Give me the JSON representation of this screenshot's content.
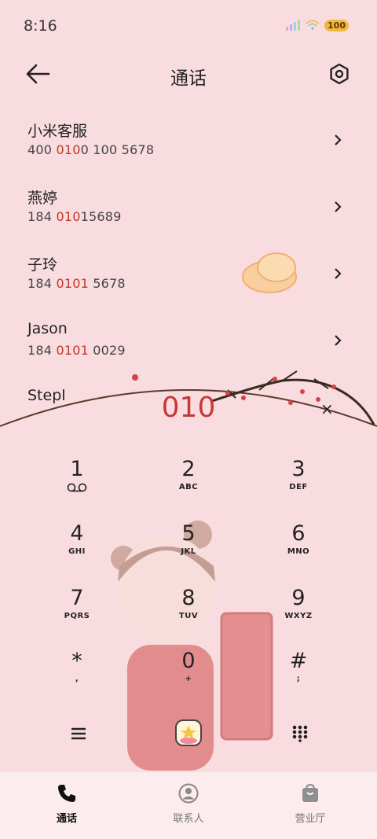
{
  "status": {
    "time": "8:16",
    "battery": "100"
  },
  "header": {
    "title": "通话"
  },
  "contacts": [
    {
      "name": "小米客服",
      "number_pre": "400 ",
      "number_hl": "010",
      "number_mid": "0 ",
      "number_hl2": "",
      "number_post": "100 5678"
    },
    {
      "name": "燕婷",
      "number_pre": "184 ",
      "number_hl": "010",
      "number_mid": "",
      "number_hl2": "",
      "number_post": "15689"
    },
    {
      "name": "子玲",
      "number_pre": "184 ",
      "number_hl": "0101",
      "number_mid": "",
      "number_hl2": "",
      "number_post": " 5678"
    },
    {
      "name": "Jason",
      "number_pre": "184 ",
      "number_hl": "0101",
      "number_mid": "",
      "number_hl2": "",
      "number_post": " 0029"
    },
    {
      "name": "Stepl",
      "number_pre": "",
      "number_hl": "",
      "number_mid": "",
      "number_hl2": "",
      "number_post": ""
    }
  ],
  "dialer": {
    "entered": "010",
    "keys": [
      {
        "digit": "1",
        "letters": ""
      },
      {
        "digit": "2",
        "letters": "ABC"
      },
      {
        "digit": "3",
        "letters": "DEF"
      },
      {
        "digit": "4",
        "letters": "GHI"
      },
      {
        "digit": "5",
        "letters": "JKL"
      },
      {
        "digit": "6",
        "letters": "MNO"
      },
      {
        "digit": "7",
        "letters": "PQRS"
      },
      {
        "digit": "8",
        "letters": "TUV"
      },
      {
        "digit": "9",
        "letters": "WXYZ"
      },
      {
        "digit": "*",
        "letters": ","
      },
      {
        "digit": "0",
        "letters": "+"
      },
      {
        "digit": "#",
        "letters": ";"
      }
    ],
    "clear_symbol": "×"
  },
  "bottom_nav": [
    {
      "label": "通话",
      "icon": "phone-icon",
      "active": true
    },
    {
      "label": "联系人",
      "icon": "contact-icon",
      "active": false
    },
    {
      "label": "营业厅",
      "icon": "shop-bag-icon",
      "active": false
    }
  ],
  "colors": {
    "background": "#f9dcdf",
    "highlight": "#c0392b",
    "dialed": "#c23a3a"
  }
}
